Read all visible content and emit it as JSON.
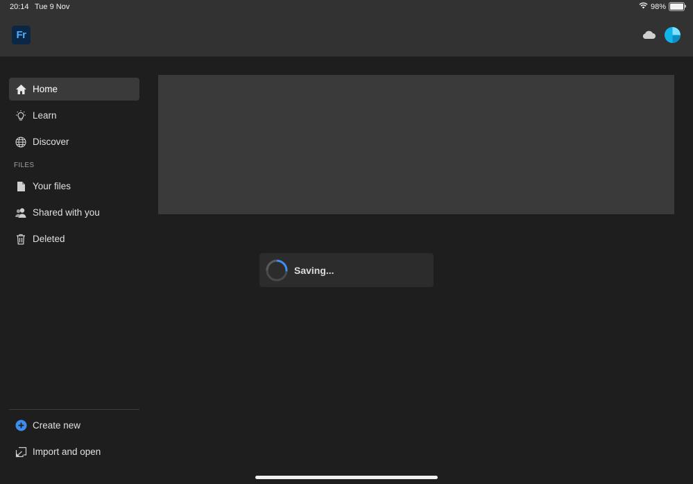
{
  "status_bar": {
    "time": "20:14",
    "date": "Tue 9 Nov",
    "battery": "98%",
    "battery_level": 0.98
  },
  "header": {
    "app_logo": "Fr",
    "icons": [
      "cloud-icon",
      "avatar"
    ],
    "accent_color": "#12b3e8"
  },
  "sidebar": {
    "items": [
      {
        "label": "Home",
        "icon": "home-icon",
        "active": true
      },
      {
        "label": "Learn",
        "icon": "lightbulb-icon"
      },
      {
        "label": "Discover",
        "icon": "globe-icon"
      }
    ],
    "files_section_label": "FILES",
    "files_items": [
      {
        "label": "Your files",
        "icon": "file-icon"
      },
      {
        "label": "Shared with you",
        "icon": "shared-users-icon"
      },
      {
        "label": "Deleted",
        "icon": "trash-icon"
      }
    ],
    "bottom_items": [
      {
        "label": "Create new",
        "icon": "plus-circle-icon"
      },
      {
        "label": "Import and open",
        "icon": "import-icon"
      }
    ]
  },
  "toast": {
    "label": "Saving..."
  },
  "colors": {
    "background": "#1e1e1e",
    "topbar": "#323232",
    "spinner": "#3e8ef0",
    "create_new_icon": "#3e8ef0"
  }
}
